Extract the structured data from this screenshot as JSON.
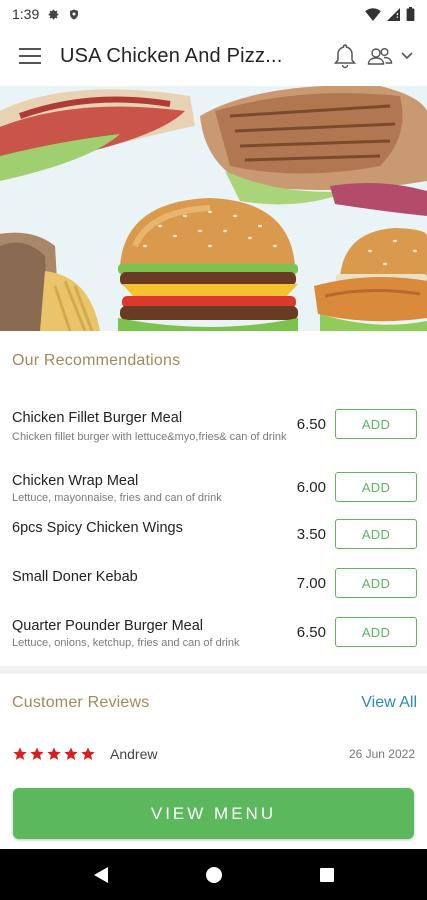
{
  "status_bar": {
    "time": "1:39"
  },
  "app_bar": {
    "title": "USA Chicken And Pizz..."
  },
  "recommendations": {
    "title": "Our Recommendations",
    "add_label": "ADD",
    "items": [
      {
        "name": "Chicken Fillet Burger Meal",
        "description": "Chicken fillet burger with lettuce&myo,fries& can of drink",
        "price": "6.50"
      },
      {
        "name": "Chicken Wrap Meal",
        "description": "Lettuce, mayonnaise, fries and can of drink",
        "price": "6.00"
      },
      {
        "name": "6pcs Spicy Chicken Wings",
        "description": "",
        "price": "3.50"
      },
      {
        "name": "Small Doner Kebab",
        "description": "",
        "price": "7.00"
      },
      {
        "name": "Quarter Pounder Burger Meal",
        "description": "Lettuce, onions, ketchup, fries and can of drink",
        "price": "6.50"
      }
    ]
  },
  "reviews": {
    "title": "Customer Reviews",
    "view_all": "View All",
    "items": [
      {
        "name": "Andrew",
        "date": "26 Jun 2022",
        "rating": 5
      }
    ]
  },
  "cta": {
    "label": "VIEW MENU"
  },
  "colors": {
    "accent": "#5cb85c",
    "section_title": "#a08a5a",
    "link": "#2a8ab8",
    "star": "#d62020"
  }
}
